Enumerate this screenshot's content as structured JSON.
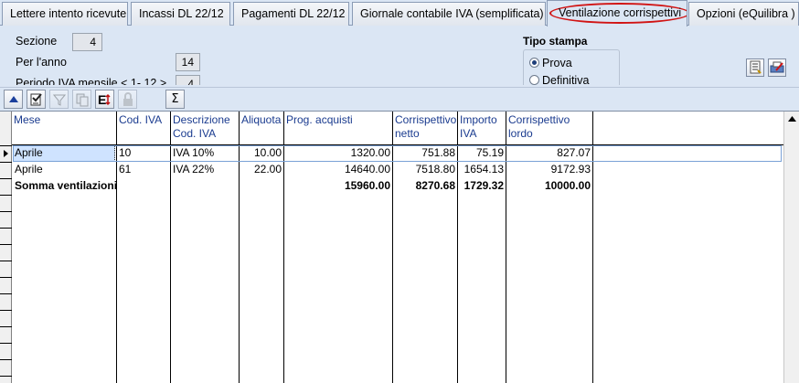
{
  "tabs": [
    {
      "label": "Lettere intento ricevute",
      "active": false
    },
    {
      "label": "Incassi DL 22/12",
      "active": false
    },
    {
      "label": "Pagamenti DL 22/12",
      "active": false
    },
    {
      "label": "Giornale contabile IVA (semplificata)",
      "active": false
    },
    {
      "label": "Ventilazione corrispettivi",
      "active": true
    },
    {
      "label": "Opzioni (eQuilibra )",
      "active": false
    }
  ],
  "form": {
    "sezione_label": "Sezione",
    "sezione_value": "4",
    "anno_label": "Per l'anno",
    "anno_value": "14",
    "periodo_label": "Periodo IVA mensile < 1- 12 >",
    "periodo_value": "4",
    "tipo_stampa_label": "Tipo stampa",
    "radio_prova": "Prova",
    "radio_definitiva": "Definitiva",
    "selected": "Prova"
  },
  "toolbar_icons": [
    "arrow-up-icon",
    "edit-check-icon",
    "filter-icon",
    "copy-icon",
    "excel-export-icon",
    "lock-icon",
    "sum-icon"
  ],
  "grid": {
    "columns": [
      "Mese",
      "Cod. IVA",
      "Descrizione Cod. IVA",
      "Aliquota",
      "Prog. acquisti",
      "Corrispettivo netto",
      "Importo IVA",
      "Corrispettivo lordo"
    ],
    "rows": [
      [
        "Aprile",
        "10",
        "IVA 10%",
        "10.00",
        "1320.00",
        "751.88",
        "75.19",
        "827.07"
      ],
      [
        "Aprile",
        "61",
        "IVA 22%",
        "22.00",
        "14640.00",
        "7518.80",
        "1654.13",
        "9172.93"
      ]
    ],
    "total": [
      "Somma ventilazioni",
      "",
      "",
      "",
      "15960.00",
      "8270.68",
      "1729.32",
      "10000.00"
    ]
  },
  "colors": {
    "background": "#dbe6f4",
    "header_text": "#1a3b8f",
    "active_tab_highlight": "#d11414"
  }
}
